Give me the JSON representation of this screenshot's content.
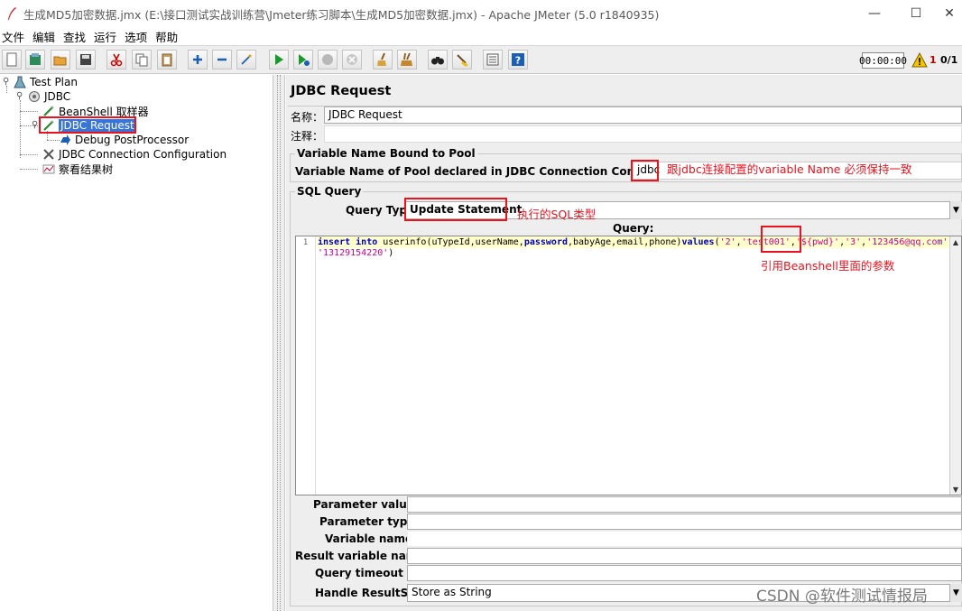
{
  "window": {
    "title": "生成MD5加密数据.jmx (E:\\接口测试实战训练营\\Jmeter练习脚本\\生成MD5加密数据.jmx) - Apache JMeter (5.0 r1840935)",
    "minimize": "—",
    "maximize": "☐",
    "close": "✕"
  },
  "menu": [
    "文件",
    "编辑",
    "查找",
    "运行",
    "选项",
    "帮助"
  ],
  "toolbar": {
    "timer": "00:00:00",
    "warning_count": "1",
    "threads": "0/1"
  },
  "tree": {
    "nodes": [
      {
        "label": "Test Plan",
        "icon": "test-plan-icon"
      },
      {
        "label": "JDBC",
        "icon": "thread-group-icon"
      },
      {
        "label": "BeanShell 取样器",
        "icon": "sampler-icon"
      },
      {
        "label": "JDBC Request",
        "icon": "sampler-icon",
        "selected": true
      },
      {
        "label": "Debug PostProcessor",
        "icon": "postprocessor-icon"
      },
      {
        "label": "JDBC Connection Configuration",
        "icon": "config-icon"
      },
      {
        "label": "察看结果树",
        "icon": "listener-icon"
      }
    ]
  },
  "panel": {
    "heading": "JDBC Request",
    "name_label": "名称：",
    "name_value": "JDBC Request",
    "comment_label": "注释：",
    "comment_value": "",
    "pool_section_title": "Variable Name Bound to Pool",
    "pool_label": "Variable Name of Pool declared in JDBC Connection Configuration:",
    "pool_value": "jdbc",
    "sql_section_title": "SQL Query",
    "query_type_label": "Query Type:",
    "query_type_value": "Update Statement",
    "query_label": "Query:",
    "line_number": "1",
    "params": {
      "parameter_values_label": "Parameter values:",
      "parameter_types_label": "Parameter types:",
      "variable_names_label": "Variable names:",
      "result_variable_name_label": "Result variable name:",
      "query_timeout_label": "Query timeout (s):",
      "handle_resultset_label": "Handle ResultSet:",
      "handle_resultset_value": "Store as String"
    }
  },
  "code": {
    "kw_insert": "insert",
    "kw_into": "into",
    "table_cols": "userinfo(uTypeId,userName,",
    "kw_password": "password",
    "cols_rest": ",babyAge,email,phone)",
    "kw_values": "values",
    "open": "(",
    "s1": "'2'",
    "comma": ",",
    "s2": "'test001'",
    "s3": "'${pwd}'",
    "s4": "'3'",
    "s5": "'123456@qq.com'",
    "s6": "'13129154220'",
    "close": ")"
  },
  "annotations": {
    "pool_note": "跟jdbc连接配置的variable Name 必须保持一致",
    "query_type_note": "执行的SQL类型",
    "param_note": "引用Beanshell里面的参数"
  },
  "watermark": "CSDN @软件测试情报局",
  "colors": {
    "annotation_red": "#e8131f",
    "selection_blue": "#3875d7",
    "keyword_blue": "#0000c8",
    "string_magenta": "#c8008c"
  }
}
